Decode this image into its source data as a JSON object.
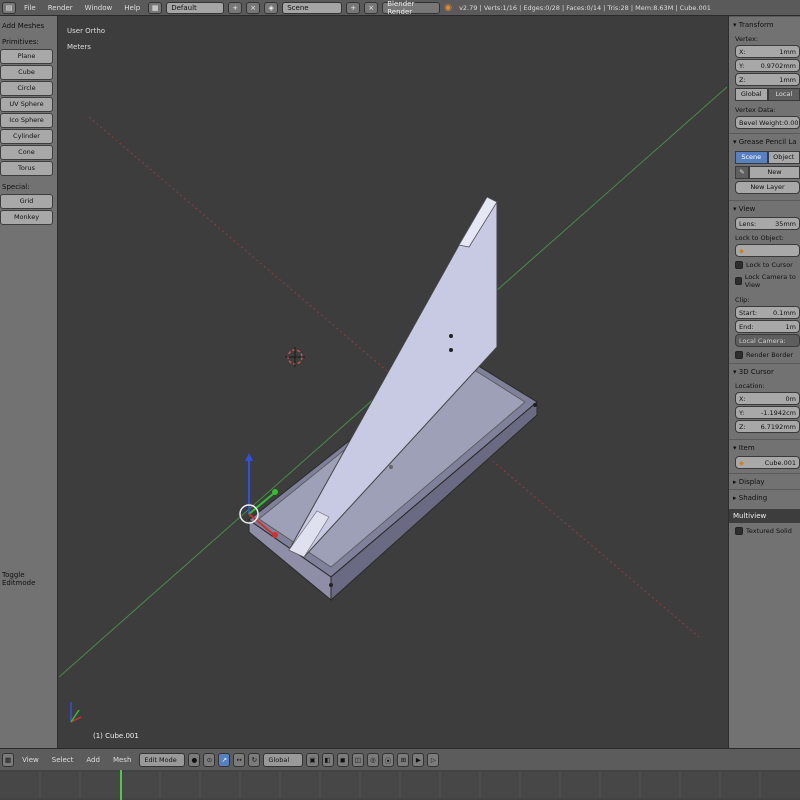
{
  "topbar": {
    "menus": [
      "File",
      "Render",
      "Window",
      "Help"
    ],
    "screen_layout": "Default",
    "scene": "Scene",
    "engine": "Blender Render",
    "stats": "v2.79 | Verts:1/16 | Edges:0/28 | Faces:0/14 | Tris:28 | Mem:8.63M | Cube.001"
  },
  "left_panel": {
    "title": "Add Meshes",
    "section_primitives": "Primitives:",
    "primitives": [
      "Plane",
      "Cube",
      "Circle",
      "UV Sphere",
      "Ico Sphere",
      "Cylinder",
      "Cone",
      "Torus"
    ],
    "section_special": "Special:",
    "special": [
      "Grid",
      "Monkey"
    ],
    "bottom_label": "Toggle Editmode"
  },
  "viewport": {
    "view_label": "User Ortho",
    "units_label": "Meters",
    "object_label": "(1) Cube.001"
  },
  "right_panel": {
    "transform_header": "Transform",
    "vertex_label": "Vertex:",
    "x": "X:",
    "x_val": "1mm",
    "y": "Y:",
    "y_val": "0.9702mm",
    "z": "Z:",
    "z_val": "1mm",
    "global_btn": "Global",
    "local_btn": "Local",
    "vertex_data": "Vertex Data:",
    "bevel_weight": "Bevel Weight:",
    "bevel_val": "0.00",
    "grease_header": "Grease Pencil La",
    "scene_tab": "Scene",
    "object_tab": "Object",
    "new_btn": "New",
    "new_layer": "New Layer",
    "view_header": "View",
    "lens": "Lens:",
    "lens_val": "35mm",
    "lock_to_object": "Lock to Object:",
    "lock_to_cursor": "Lock to Cursor",
    "lock_camera": "Lock Camera to View",
    "clip": "Clip:",
    "start": "Start:",
    "start_val": "0.1mm",
    "end": "End:",
    "end_val": "1m",
    "local_camera": "Local Camera:",
    "render_border": "Render Border",
    "cursor_header": "3D Cursor",
    "location": "Location:",
    "cx": "X:",
    "cx_val": "0m",
    "cy": "Y:",
    "cy_val": "-1.1942cm",
    "cz": "Z:",
    "cz_val": "6.7192mm",
    "item_header": "Item",
    "item_name": "Cube.001",
    "display_header": "Display",
    "shading_header": "Shading",
    "multiview_header": "Multiview",
    "textured_solid": "Textured Solid"
  },
  "bottombar": {
    "menus": [
      "View",
      "Select",
      "Add",
      "Mesh"
    ],
    "mode": "Edit Mode",
    "pivot": "Global"
  },
  "colors": {
    "bg": "#3d3d3d",
    "panel": "#727272",
    "accent_blue": "#5680c2",
    "mesh": "#a8a9c8",
    "axis_x": "#b84a4a",
    "axis_y": "#4fa84f",
    "axis_z": "#4060d0"
  }
}
